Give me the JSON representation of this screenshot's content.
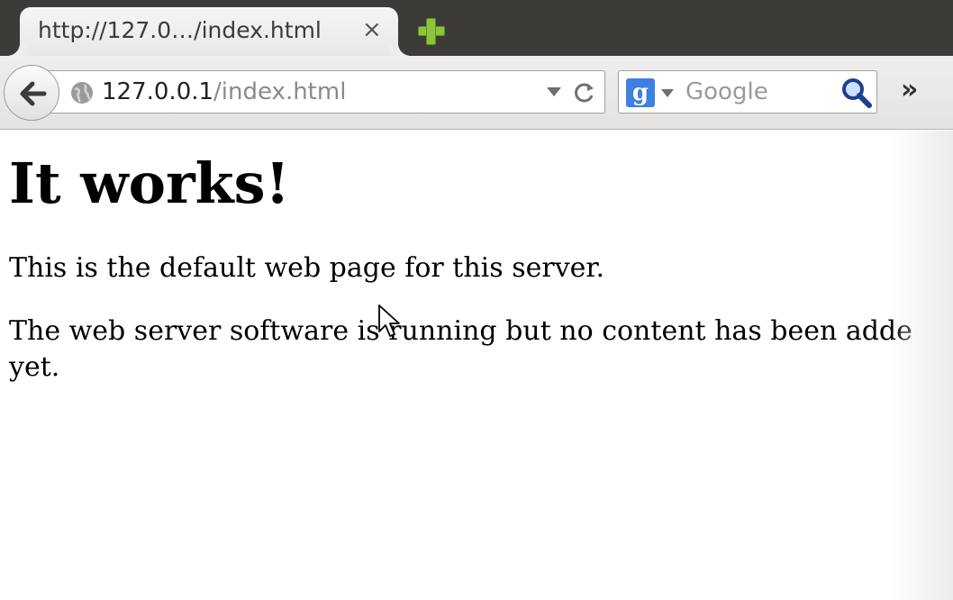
{
  "tab": {
    "title": "http://127.0…/index.html",
    "close": "×"
  },
  "navbar": {
    "url_host": "127.0.0.1",
    "url_path": "/index.html",
    "search_placeholder": "Google",
    "search_engine_letter": "g",
    "overflow": "»"
  },
  "page": {
    "heading": "It works!",
    "paragraph1": "This is the default web page for this server.",
    "paragraph2_line1": "The web server software is running but no content has been adde",
    "paragraph2_line2": "yet."
  },
  "colors": {
    "tabstrip": "#3c3b37",
    "new_tab_plus": "#8cc43e",
    "search_engine": "#3f7fe0"
  },
  "icons": [
    "back-arrow-icon",
    "globe-icon",
    "reload-icon",
    "search-engine-icon",
    "magnifier-icon",
    "new-tab-icon",
    "close-icon",
    "overflow-chevron-icon",
    "mouse-cursor-icon"
  ]
}
